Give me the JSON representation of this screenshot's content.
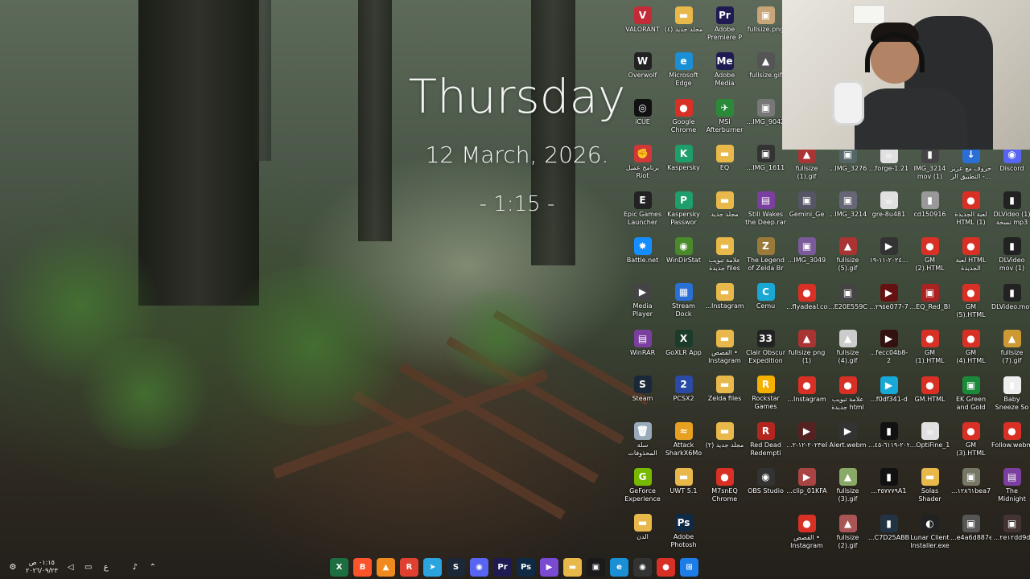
{
  "clock": {
    "day": "Thursday",
    "date": "12 March, 2026.",
    "time": "- 1:15 -"
  },
  "desktop_icons": [
    {
      "label": "VALORANT",
      "icon": "valorant-icon",
      "color": "#c22c38",
      "glyph": "V"
    },
    {
      "label": "مجلد جديد (٤)",
      "icon": "folder-icon",
      "color": "#e8b84a",
      "glyph": "▬"
    },
    {
      "label": "Adobe Premiere P",
      "icon": "premiere-icon",
      "color": "#1f1b52",
      "glyph": "Pr"
    },
    {
      "label": "fullsize.png",
      "icon": "image-file-icon",
      "color": "#c9a57a",
      "glyph": "▣"
    },
    {
      "label": "Overwolf",
      "icon": "overwolf-icon",
      "color": "#222",
      "glyph": "W"
    },
    {
      "label": "Microsoft Edge",
      "icon": "edge-icon",
      "color": "#1a8fd6",
      "glyph": "e"
    },
    {
      "label": "Adobe Media Encoder 2022",
      "icon": "media-encoder-icon",
      "color": "#1f1b52",
      "glyph": "Me"
    },
    {
      "label": "fullsize.gif",
      "icon": "gif-file-icon",
      "color": "#555",
      "glyph": "▲"
    },
    {
      "label": "iCUE",
      "icon": "icue-icon",
      "color": "#111",
      "glyph": "◎"
    },
    {
      "label": "Google Chrome",
      "icon": "chrome-icon",
      "color": "#d93025",
      "glyph": "●"
    },
    {
      "label": "MSI Afterburner",
      "icon": "afterburner-icon",
      "color": "#2a8a3a",
      "glyph": "✈"
    },
    {
      "label": "...IMG_9042",
      "icon": "image-file-icon",
      "color": "#777",
      "glyph": "▣"
    },
    {
      "label": "برنامج عميل Riot",
      "icon": "riot-icon",
      "color": "#d13639",
      "glyph": "✊"
    },
    {
      "label": "Kaspersky",
      "icon": "kaspersky-icon",
      "color": "#1e9e6a",
      "glyph": "K"
    },
    {
      "label": "EQ",
      "icon": "folder-icon",
      "color": "#e8b84a",
      "glyph": "▬"
    },
    {
      "label": "...IMG_1611",
      "icon": "image-file-icon",
      "color": "#333",
      "glyph": "▣"
    },
    {
      "label": "Epic Games Launcher",
      "icon": "epic-icon",
      "color": "#222",
      "glyph": "E"
    },
    {
      "label": "Kaspersky Passwor",
      "icon": "kaspersky-password-icon",
      "color": "#1e9e6a",
      "glyph": "P"
    },
    {
      "label": "مجلد جديد",
      "icon": "folder-icon",
      "color": "#e8b84a",
      "glyph": "▬"
    },
    {
      "label": "Still Wakes the Deep.rar",
      "icon": "winrar-archive-icon",
      "color": "#7b3fa0",
      "glyph": "▤"
    },
    {
      "label": "Battle.net",
      "icon": "battlenet-icon",
      "color": "#148eff",
      "glyph": "✸"
    },
    {
      "label": "WinDirStat",
      "icon": "windirstat-icon",
      "color": "#4a8a2a",
      "glyph": "◉"
    },
    {
      "label": "علامة تبويب جديدة files",
      "icon": "folder-icon",
      "color": "#e8b84a",
      "glyph": "▬"
    },
    {
      "label": "The Legend of Zelda Br",
      "icon": "zelda-icon",
      "color": "#9a7a3a",
      "glyph": "Z"
    },
    {
      "label": "Media Player Classic",
      "icon": "media-player-icon",
      "color": "#444",
      "glyph": "▶"
    },
    {
      "label": "Stream Dock",
      "icon": "stream-dock-icon",
      "color": "#2a6fd6",
      "glyph": "▦"
    },
    {
      "label": "...Instagram",
      "icon": "folder-icon",
      "color": "#e8b84a",
      "glyph": "▬"
    },
    {
      "label": "Cemu",
      "icon": "cemu-icon",
      "color": "#19a7d6",
      "glyph": "C"
    },
    {
      "label": "WinRAR",
      "icon": "winrar-icon",
      "color": "#7b3fa0",
      "glyph": "▤"
    },
    {
      "label": "GoXLR App",
      "icon": "goxlr-icon",
      "color": "#1b3b2b",
      "glyph": "X"
    },
    {
      "label": "القصص • Instagram",
      "icon": "folder-icon",
      "color": "#e8b84a",
      "glyph": "▬"
    },
    {
      "label": "Clair Obscur Expedition 33",
      "icon": "clair-obscur-icon",
      "color": "#222",
      "glyph": "33"
    },
    {
      "label": "Steam",
      "icon": "steam-icon",
      "color": "#1b2838",
      "glyph": "S"
    },
    {
      "label": "PCSX2",
      "icon": "pcsx2-icon",
      "color": "#2a4aa6",
      "glyph": "2"
    },
    {
      "label": "Zelda files",
      "icon": "folder-icon",
      "color": "#e8b84a",
      "glyph": "▬"
    },
    {
      "label": "Rockstar Games",
      "icon": "rockstar-icon",
      "color": "#f5b000",
      "glyph": "R"
    },
    {
      "label": "سلة المحذوفات",
      "icon": "recycle-bin-icon",
      "color": "#9ab",
      "glyph": "🗑"
    },
    {
      "label": "Attack SharkX6Mo",
      "icon": "attack-shark-icon",
      "color": "#e8a020",
      "glyph": "≈"
    },
    {
      "label": "مجلد جديد (٢)",
      "icon": "folder-icon",
      "color": "#e8b84a",
      "glyph": "▬"
    },
    {
      "label": "Red Dead Redempti",
      "icon": "red-dead-icon",
      "color": "#b3261e",
      "glyph": "R"
    },
    {
      "label": "GeForce Experience",
      "icon": "geforce-icon",
      "color": "#76b900",
      "glyph": "G"
    },
    {
      "label": "UWT 5.1",
      "icon": "folder-icon",
      "color": "#e8b84a",
      "glyph": "▬"
    },
    {
      "label": "M7snEQ Chrome",
      "icon": "chrome-icon",
      "color": "#d93025",
      "glyph": "●"
    },
    {
      "label": "OBS Studio",
      "icon": "obs-icon",
      "color": "#333",
      "glyph": "◉"
    },
    {
      "label": "الدن",
      "icon": "folder-icon",
      "color": "#e8b84a",
      "glyph": "▬"
    },
    {
      "label": "Adobe Photosh",
      "icon": "photoshop-icon",
      "color": "#0f2a44",
      "glyph": "Ps"
    },
    {
      "label": "Gemini_Ge",
      "icon": "image-file-icon",
      "color": "#556",
      "glyph": "▣"
    },
    {
      "label": "...IMG_3214",
      "icon": "image-file-icon",
      "color": "#667",
      "glyph": "▣"
    },
    {
      "label": "gre-8u481",
      "icon": "java-file-icon",
      "color": "#e0e0e0",
      "glyph": "☕"
    },
    {
      "label": "cd150916",
      "icon": "file-icon",
      "color": "#999",
      "glyph": "▮"
    },
    {
      "label": "لعبة الجديدة HTML (1)",
      "icon": "chrome-html-icon",
      "color": "#d93025",
      "glyph": "●"
    },
    {
      "label": "DLVideo (1) نسخة mp3",
      "icon": "file-icon",
      "color": "#222",
      "glyph": "▮"
    },
    {
      "label": "...IMG_3049",
      "icon": "image-file-icon",
      "color": "#7a5a9a",
      "glyph": "▣"
    },
    {
      "label": "fullsize (5).gif",
      "icon": "gif-file-icon",
      "color": "#a33",
      "glyph": "▲"
    },
    {
      "label": "٢٠٢٤-١١-١٩...",
      "icon": "video-file-icon",
      "color": "#333",
      "glyph": "▶"
    },
    {
      "label": "GM (2).HTML",
      "icon": "chrome-html-icon",
      "color": "#d93025",
      "glyph": "●"
    },
    {
      "label": "لعبة HTML الجديدة",
      "icon": "chrome-html-icon",
      "color": "#d93025",
      "glyph": "●"
    },
    {
      "label": "DLVideo mov (1)",
      "icon": "file-icon",
      "color": "#222",
      "glyph": "▮"
    },
    {
      "label": "...flyadeal.co",
      "icon": "chrome-html-icon",
      "color": "#d93025",
      "glyph": "●"
    },
    {
      "label": "...E20E559C",
      "icon": "image-file-icon",
      "color": "#444",
      "glyph": "▣"
    },
    {
      "label": "...٢٩٥e077-7",
      "icon": "video-file-icon",
      "color": "#611",
      "glyph": "▶"
    },
    {
      "label": "...EQ_Red_Bl",
      "icon": "image-file-icon",
      "color": "#a22",
      "glyph": "▣"
    },
    {
      "label": "GM (5).HTML",
      "icon": "chrome-html-icon",
      "color": "#d93025",
      "glyph": "●"
    },
    {
      "label": "DLVideo.mov",
      "icon": "file-icon",
      "color": "#222",
      "glyph": "▮"
    },
    {
      "label": "fullsize png (1)",
      "icon": "gif-file-icon",
      "color": "#a33",
      "glyph": "▲"
    },
    {
      "label": "fullsize (4).gif",
      "icon": "gif-file-icon",
      "color": "#ccc",
      "glyph": "▲"
    },
    {
      "label": "...fecc04b8-2",
      "icon": "video-file-icon",
      "color": "#311",
      "glyph": "▶"
    },
    {
      "label": "GM (1).HTML",
      "icon": "chrome-html-icon",
      "color": "#d93025",
      "glyph": "●"
    },
    {
      "label": "GM (4).HTML",
      "icon": "chrome-html-icon",
      "color": "#d93025",
      "glyph": "●"
    },
    {
      "label": "fullsize (7).gif",
      "icon": "gif-file-icon",
      "color": "#c93",
      "glyph": "▲"
    },
    {
      "label": "...Instagram",
      "icon": "chrome-html-icon",
      "color": "#d93025",
      "glyph": "●"
    },
    {
      "label": "علامة تبويب جديدة html",
      "icon": "chrome-html-icon",
      "color": "#d93025",
      "glyph": "●"
    },
    {
      "label": "...f0df341-d",
      "icon": "video-file-icon",
      "color": "#18a8d8",
      "glyph": "▶"
    },
    {
      "label": "GM.HTML",
      "icon": "chrome-html-icon",
      "color": "#d93025",
      "glyph": "●"
    },
    {
      "label": "EK Green and Gold Sparkl",
      "icon": "image-file-icon",
      "color": "#1a8a3a",
      "glyph": "▣"
    },
    {
      "label": "Baby Sneeze So",
      "icon": "file-icon",
      "color": "#eee",
      "glyph": "▮"
    },
    {
      "label": "...٢٠٢٣-١٢-٢e8f5",
      "icon": "video-file-icon",
      "color": "#522",
      "glyph": "▶"
    },
    {
      "label": "Alert.webm",
      "icon": "video-file-icon",
      "color": "#333",
      "glyph": "▶"
    },
    {
      "label": "...٢٠٢٤-٦١١٩-٤٥",
      "icon": "file-icon",
      "color": "#111",
      "glyph": "▮"
    },
    {
      "label": "...OptiFine_1",
      "icon": "java-file-icon",
      "color": "#e0e0e0",
      "glyph": "☕"
    },
    {
      "label": "GM (3).HTML",
      "icon": "chrome-html-icon",
      "color": "#d93025",
      "glyph": "●"
    },
    {
      "label": "Follow.webm",
      "icon": "chrome-html-icon",
      "color": "#d93025",
      "glyph": "●"
    },
    {
      "label": "...clip_01KFA",
      "icon": "video-file-icon",
      "color": "#a44",
      "glyph": "▶"
    },
    {
      "label": "fullsize (3).gif",
      "icon": "gif-file-icon",
      "color": "#8a6",
      "glyph": "▲"
    },
    {
      "label": "...٣٥٧٧٧٩A1",
      "icon": "file-icon",
      "color": "#111",
      "glyph": "▮"
    },
    {
      "label": "Solas Shader V3.3.zip",
      "icon": "zip-folder-icon",
      "color": "#e8b84a",
      "glyph": "▬"
    },
    {
      "label": "...١٢٨٦١bea7",
      "icon": "image-file-icon",
      "color": "#776",
      "glyph": "▣"
    },
    {
      "label": "The Midnight Walk.rar",
      "icon": "winrar-archive-icon",
      "color": "#7b3fa0",
      "glyph": "▤"
    },
    {
      "label": "القصص • Instagram",
      "icon": "chrome-html-icon",
      "color": "#d93025",
      "glyph": "●"
    },
    {
      "label": "fullsize (2).gif",
      "icon": "gif-file-icon",
      "color": "#a55",
      "glyph": "▲"
    },
    {
      "label": "...C7D25ABB",
      "icon": "file-icon",
      "color": "#234",
      "glyph": "▮"
    },
    {
      "label": "Lunar Client Installer.exe",
      "icon": "lunar-client-icon",
      "color": "#222",
      "glyph": "◐"
    },
    {
      "label": "...e4a6d887e",
      "icon": "image-file-icon",
      "color": "#555",
      "glyph": "▣"
    },
    {
      "label": "...٢e١٢dd9d",
      "icon": "image-file-icon",
      "color": "#433",
      "glyph": "▣"
    },
    {
      "label": "fullsize (1).gif",
      "icon": "gif-file-icon",
      "color": "#a33",
      "glyph": "▲"
    },
    {
      "label": "...IMG_3276",
      "icon": "image-file-icon",
      "color": "#566",
      "glyph": "▣"
    },
    {
      "label": "...forge-1.21",
      "icon": "java-file-icon",
      "color": "#e0e0e0",
      "glyph": "☕"
    },
    {
      "label": "IMG_3214 mov (1)",
      "icon": "file-icon",
      "color": "#444",
      "glyph": "▮"
    },
    {
      "label": "حروف مع عزيز - التطبيق الر...",
      "icon": "download-icon",
      "color": "#2a6fd6",
      "glyph": "↓"
    },
    {
      "label": "Discord",
      "icon": "discord-icon",
      "color": "#5865f2",
      "glyph": "◉"
    }
  ],
  "taskbar": {
    "time": "٠١:١٥ ص",
    "date": "٢٠٢٦/٠٩/٢٣",
    "lang": "ع",
    "apps": [
      {
        "name": "excel",
        "glyph": "X",
        "color": "#1d6f42"
      },
      {
        "name": "brave",
        "glyph": "B",
        "color": "#fb542b"
      },
      {
        "name": "vlc",
        "glyph": "▲",
        "color": "#f08a1c"
      },
      {
        "name": "roblox",
        "glyph": "R",
        "color": "#e04030"
      },
      {
        "name": "telegram",
        "glyph": "➤",
        "color": "#2aa3de"
      },
      {
        "name": "steam",
        "glyph": "S",
        "color": "#1b2838"
      },
      {
        "name": "discord",
        "glyph": "◉",
        "color": "#5865f2"
      },
      {
        "name": "premiere",
        "glyph": "Pr",
        "color": "#1f1b52"
      },
      {
        "name": "photoshop",
        "glyph": "Ps",
        "color": "#0f2a44"
      },
      {
        "name": "stream-deck",
        "glyph": "▶",
        "color": "#7a4bd1"
      },
      {
        "name": "file-explorer",
        "glyph": "▬",
        "color": "#e8b84a"
      },
      {
        "name": "store",
        "glyph": "▣",
        "color": "#1a1a1a"
      },
      {
        "name": "edge",
        "glyph": "e",
        "color": "#1a8fd6"
      },
      {
        "name": "obs",
        "glyph": "◉",
        "color": "#333"
      },
      {
        "name": "chrome",
        "glyph": "●",
        "color": "#d93025"
      },
      {
        "name": "start",
        "glyph": "⊞",
        "color": "#1c7de8"
      }
    ]
  }
}
